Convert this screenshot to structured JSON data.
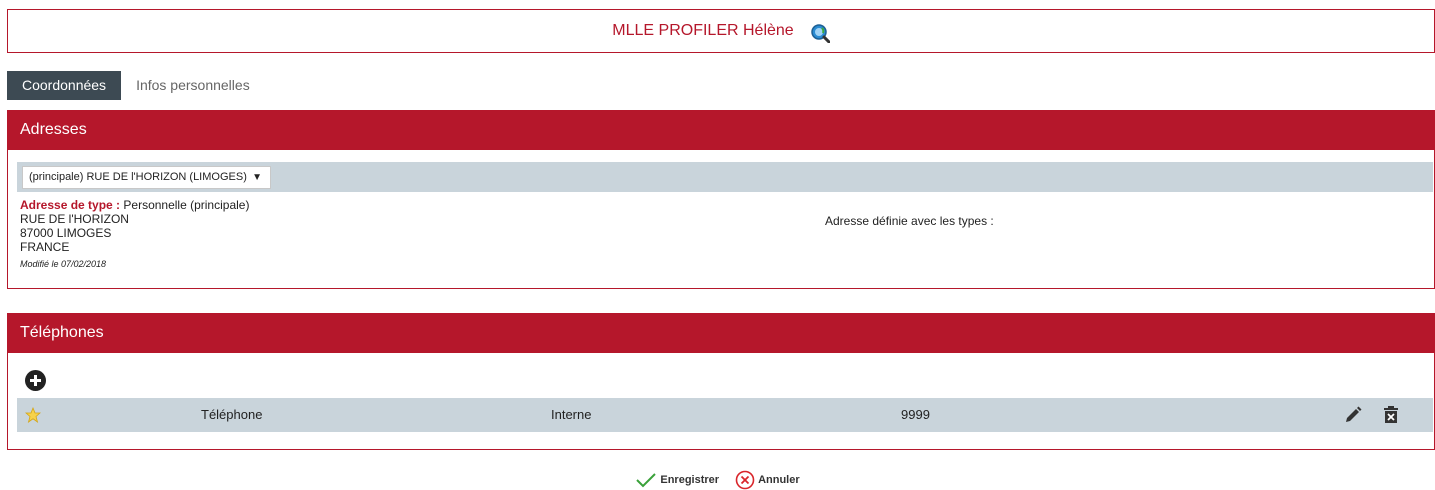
{
  "header": {
    "profile_name": "MLLE PROFILER Hélène",
    "icon": "search-profile-icon",
    "accent_color": "#b5172b"
  },
  "tabs": [
    {
      "label": "Coordonnées",
      "active": true
    },
    {
      "label": "Infos personnelles",
      "active": false
    }
  ],
  "addresses": {
    "title": "Adresses",
    "select_value": "(principale) RUE DE l'HORIZON (LIMOGES)",
    "type_label": "Adresse de type :",
    "type_value": "Personnelle (principale)",
    "line1": "RUE DE l'HORIZON",
    "line2": "87000  LIMOGES",
    "line3": "FRANCE",
    "modified": "Modifié le 07/02/2018",
    "types_label": "Adresse définie avec les types :"
  },
  "phones": {
    "title": "Téléphones",
    "rows": [
      {
        "label": "Téléphone",
        "category": "Interne",
        "number": "9999"
      }
    ]
  },
  "actions": {
    "save_label": "Enregistrer",
    "cancel_label": "Annuler"
  }
}
